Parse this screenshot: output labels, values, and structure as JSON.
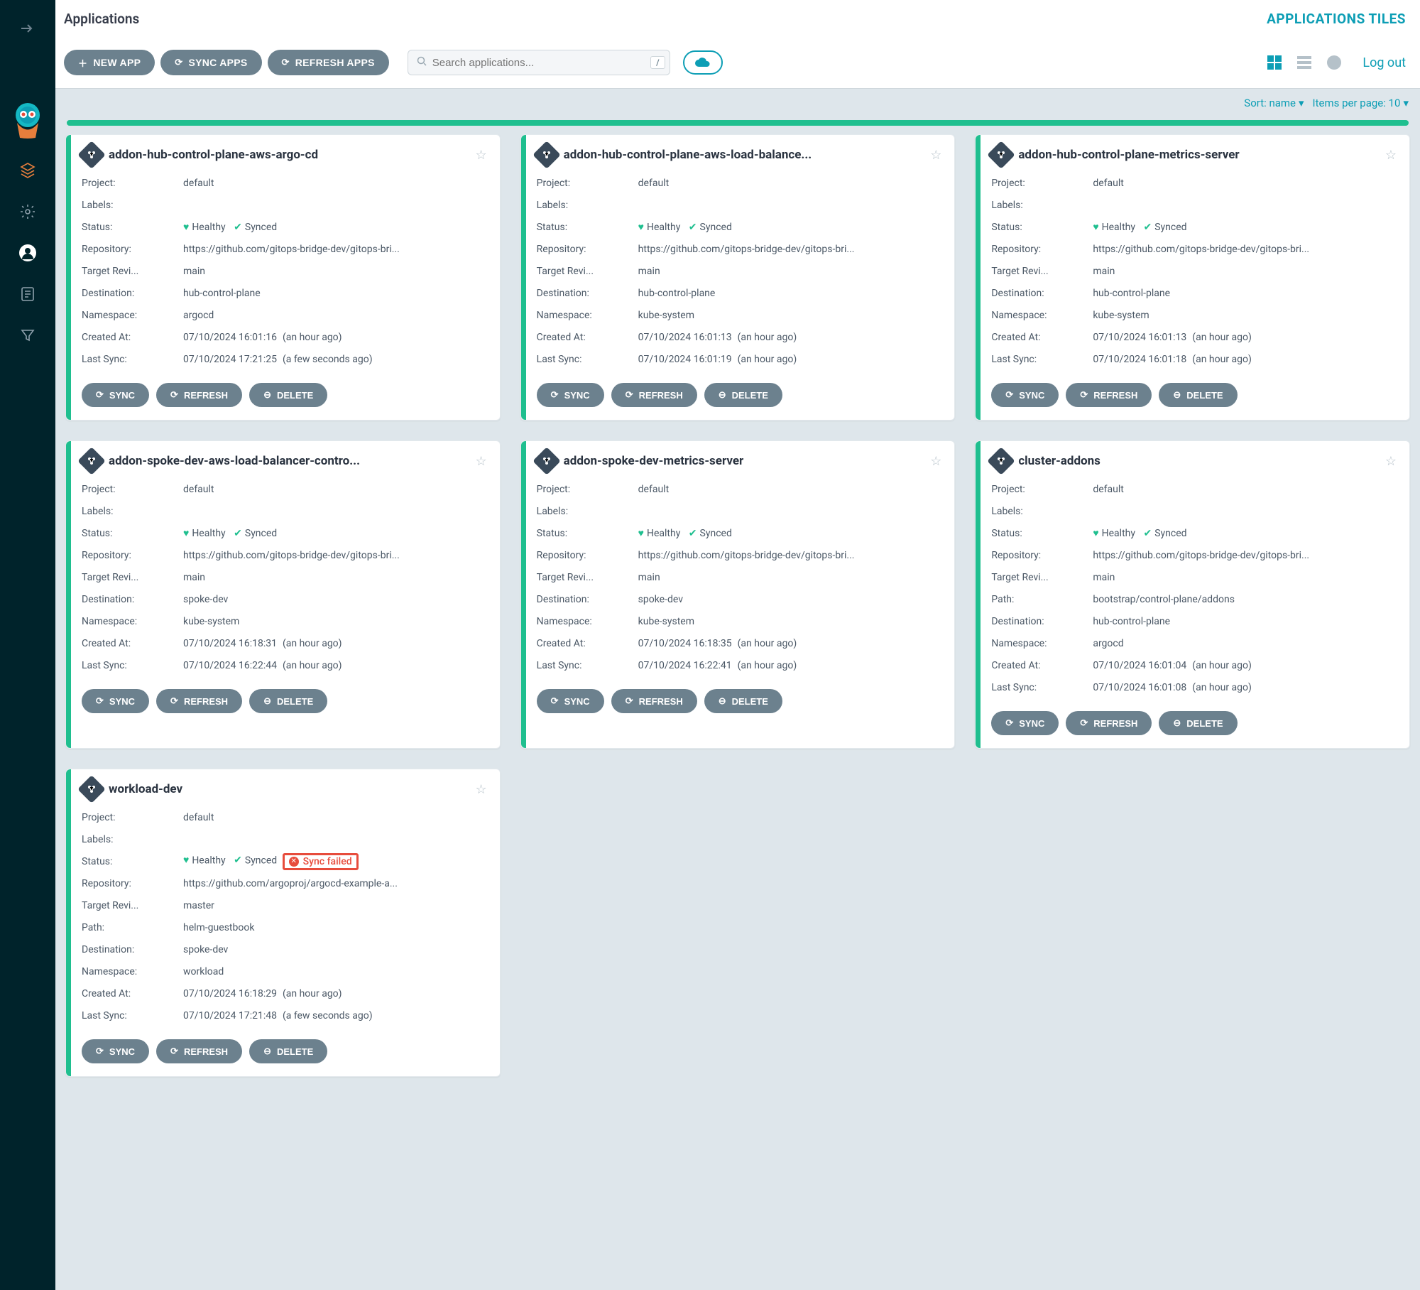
{
  "header": {
    "crumb": "Applications",
    "view_label": "APPLICATIONS TILES",
    "new_app": "NEW APP",
    "sync_apps": "SYNC APPS",
    "refresh_apps": "REFRESH APPS",
    "search_placeholder": "Search applications...",
    "kbd": "/",
    "logout": "Log out"
  },
  "sortbar": {
    "sort_label": "Sort: name",
    "items_label": "Items per page: 10"
  },
  "labels": {
    "project": "Project:",
    "labels": "Labels:",
    "status": "Status:",
    "repository": "Repository:",
    "target_rev": "Target Revi...",
    "path": "Path:",
    "destination": "Destination:",
    "namespace": "Namespace:",
    "created_at": "Created At:",
    "last_sync": "Last Sync:",
    "sync": "SYNC",
    "refresh": "REFRESH",
    "delete": "DELETE",
    "healthy": "Healthy",
    "synced": "Synced",
    "sync_failed": "Sync failed"
  },
  "apps": [
    {
      "name": "addon-hub-control-plane-aws-argo-cd",
      "project": "default",
      "status_health": "Healthy",
      "status_sync": "Synced",
      "repo": "https://github.com/gitops-bridge-dev/gitops-bri...",
      "target": "main",
      "dest": "hub-control-plane",
      "ns": "argocd",
      "created": "07/10/2024 16:01:16",
      "created_rel": "(an hour ago)",
      "last_sync": "07/10/2024 17:21:25",
      "last_sync_rel": "(a few seconds ago)",
      "failed": false
    },
    {
      "name": "addon-hub-control-plane-aws-load-balance...",
      "project": "default",
      "status_health": "Healthy",
      "status_sync": "Synced",
      "repo": "https://github.com/gitops-bridge-dev/gitops-bri...",
      "target": "main",
      "dest": "hub-control-plane",
      "ns": "kube-system",
      "created": "07/10/2024 16:01:13",
      "created_rel": "(an hour ago)",
      "last_sync": "07/10/2024 16:01:19",
      "last_sync_rel": "(an hour ago)",
      "failed": false
    },
    {
      "name": "addon-hub-control-plane-metrics-server",
      "project": "default",
      "status_health": "Healthy",
      "status_sync": "Synced",
      "repo": "https://github.com/gitops-bridge-dev/gitops-bri...",
      "target": "main",
      "dest": "hub-control-plane",
      "ns": "kube-system",
      "created": "07/10/2024 16:01:13",
      "created_rel": "(an hour ago)",
      "last_sync": "07/10/2024 16:01:18",
      "last_sync_rel": "(an hour ago)",
      "failed": false
    },
    {
      "name": "addon-spoke-dev-aws-load-balancer-contro...",
      "project": "default",
      "status_health": "Healthy",
      "status_sync": "Synced",
      "repo": "https://github.com/gitops-bridge-dev/gitops-bri...",
      "target": "main",
      "dest": "spoke-dev",
      "ns": "kube-system",
      "created": "07/10/2024 16:18:31",
      "created_rel": "(an hour ago)",
      "last_sync": "07/10/2024 16:22:44",
      "last_sync_rel": "(an hour ago)",
      "failed": false
    },
    {
      "name": "addon-spoke-dev-metrics-server",
      "project": "default",
      "status_health": "Healthy",
      "status_sync": "Synced",
      "repo": "https://github.com/gitops-bridge-dev/gitops-bri...",
      "target": "main",
      "dest": "spoke-dev",
      "ns": "kube-system",
      "created": "07/10/2024 16:18:35",
      "created_rel": "(an hour ago)",
      "last_sync": "07/10/2024 16:22:41",
      "last_sync_rel": "(an hour ago)",
      "failed": false
    },
    {
      "name": "cluster-addons",
      "project": "default",
      "status_health": "Healthy",
      "status_sync": "Synced",
      "repo": "https://github.com/gitops-bridge-dev/gitops-bri...",
      "target": "main",
      "path": "bootstrap/control-plane/addons",
      "dest": "hub-control-plane",
      "ns": "argocd",
      "created": "07/10/2024 16:01:04",
      "created_rel": "(an hour ago)",
      "last_sync": "07/10/2024 16:01:08",
      "last_sync_rel": "(an hour ago)",
      "failed": false
    },
    {
      "name": "workload-dev",
      "project": "default",
      "status_health": "Healthy",
      "status_sync": "Synced",
      "repo": "https://github.com/argoproj/argocd-example-a...",
      "target": "master",
      "path": "helm-guestbook",
      "dest": "spoke-dev",
      "ns": "workload",
      "created": "07/10/2024 16:18:29",
      "created_rel": "(an hour ago)",
      "last_sync": "07/10/2024 17:21:48",
      "last_sync_rel": "(a few seconds ago)",
      "failed": true
    }
  ]
}
